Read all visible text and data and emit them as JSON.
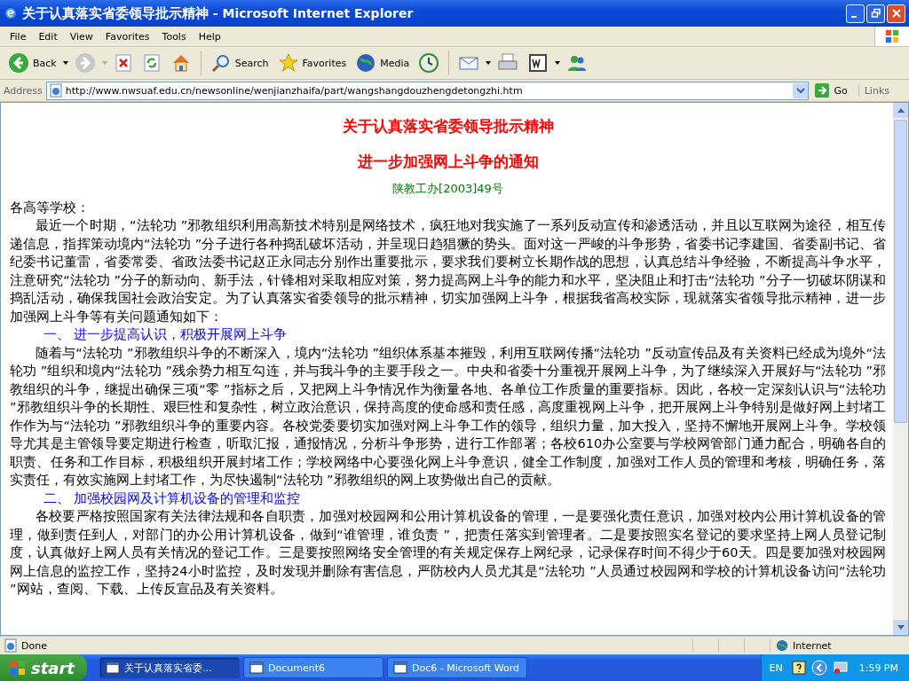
{
  "window": {
    "title_doc": "关于认真落实省委领导批示精神",
    "title_app": " - Microsoft Internet Explorer"
  },
  "menu": [
    "File",
    "Edit",
    "View",
    "Favorites",
    "Tools",
    "Help"
  ],
  "toolbar": {
    "back": "Back",
    "search": "Search",
    "favorites": "Favorites",
    "media": "Media"
  },
  "address": {
    "label": "Address",
    "url": "http://www.nwsuaf.edu.cn/newsonline/wenjianzhaifa/part/wangshangdouzhengdetongzhi.htm",
    "go": "Go",
    "links": "Links"
  },
  "document": {
    "title_lines": [
      "关于认真落实省委领导批示精神",
      "进一步加强网上斗争的通知"
    ],
    "doc_number": "陕教工办[2003]49号",
    "salutation": "各高等学校：",
    "blocks": [
      {
        "kind": "paragraph",
        "text": "最近一个时期，“法轮功 ”邪教组织利用高新技术特别是网络技术，疯狂地对我实施了一系列反动宣传和渗透活动，并且以互联网为途径，相互传递信息，指挥策动境内“法轮功 ”分子进行各种捣乱破坏活动，并呈现日趋猖獗的势头。面对这一严峻的斗争形势，省委书记李建国、省委副书记、省纪委书记董雷，省委常委、省政法委书记赵正永同志分别作出重要批示，要求我们要树立长期作战的思想，认真总结斗争经验，不断提高斗争水平，注意研究“法轮功 ”分子的新动向、新手法，针锋相对采取相应对策，努力提高网上斗争的能力和水平，坚决阻止和打击“法轮功 ”分子一切破坏阴谋和捣乱活动，确保我国社会政治安定。为了认真落实省委领导的批示精神，切实加强网上斗争，根据我省高校实际，现就落实省领导批示精神，进一步加强网上斗争等有关问题通知如下："
      },
      {
        "kind": "heading",
        "text": "一、 进一步提高认识，积极开展网上斗争"
      },
      {
        "kind": "paragraph",
        "text": "随着与“法轮功 ”邪教组织斗争的不断深入，境内“法轮功 ”组织体系基本摧毁，利用互联网传播“法轮功 ”反动宣传品及有关资料已经成为境外“法轮功 ”组织和境内“法轮功 ”残余势力相互勾连，并与我斗争的主要手段之一。中央和省委十分重视开展网上斗争，为了继续深入开展好与“法轮功 ”邪教组织的斗争，继提出确保三项“零 ”指标之后，又把网上斗争情况作为衡量各地、各单位工作质量的重要指标。因此，各校一定深刻认识与“法轮功 ”邪教组织斗争的长期性、艰巨性和复杂性，树立政治意识，保持高度的使命感和责任感，高度重视网上斗争，把开展网上斗争特别是做好网上封堵工作作为与“法轮功 ”邪教组织斗争的重要内容。各校党委要切实加强对网上斗争工作的领导，组织力量，加大投入，坚持不懈地开展网上斗争。学校领导尤其是主管领导要定期进行检查，听取汇报，通报情况，分析斗争形势，进行工作部署；各校610办公室要与学校网管部门通力配合，明确各自的职责、任务和工作目标，积极组织开展封堵工作；学校网络中心要强化网上斗争意识，健全工作制度，加强对工作人员的管理和考核，明确任务，落实责任，有效实施网上封堵工作，为尽快遏制“法轮功 ”邪教组织的网上攻势做出自己的贡献。"
      },
      {
        "kind": "heading",
        "text": "二、 加强校园网及计算机设备的管理和监控"
      },
      {
        "kind": "paragraph",
        "text": "各校要严格按照国家有关法律法规和各自职责，加强对校园网和公用计算机设备的管理，一是要强化责任意识，加强对校内公用计算机设备的管理，做到责任到人，对部门的办公用计算机设备，做到“谁管理，谁负责 ”，把责任落实到管理者。二是要按照实名登记的要求坚持上网人员登记制度，认真做好上网人员有关情况的登记工作。三是要按照网络安全管理的有关规定保存上网纪录，记录保存时间不得少于60天。四是要加强对校园网网上信息的监控工作，坚持24小时监控，及时发现并删除有害信息，严防校内人员尤其是“法轮功 ”人员通过校园网和学校的计算机设备访问“法轮功 ”网站，查阅、下载、上传反宣品及有关资料。"
      }
    ]
  },
  "status_bar": {
    "text": "Done",
    "zone": "Internet"
  },
  "taskbar": {
    "start": "start",
    "tasks": [
      {
        "label": "关于认真落实省委...",
        "selected": true
      },
      {
        "label": "Document6",
        "selected": false
      },
      {
        "label": "Doc6 - Microsoft Word",
        "selected": false
      }
    ],
    "language": "EN",
    "clock": "1:59 PM"
  }
}
